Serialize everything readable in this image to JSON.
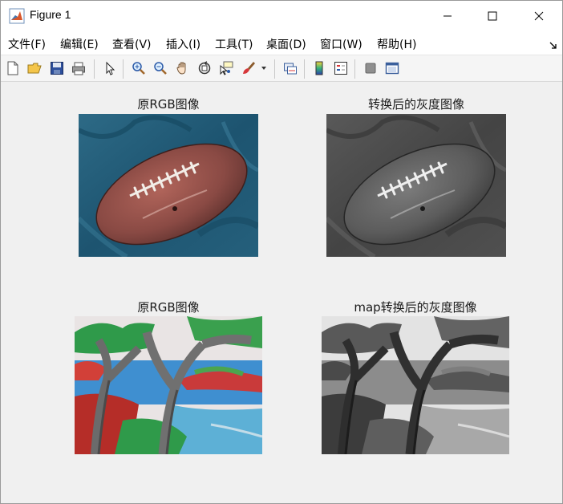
{
  "window": {
    "title": "Figure 1"
  },
  "menu": {
    "items": [
      {
        "label": "文件(F)"
      },
      {
        "label": "编辑(E)"
      },
      {
        "label": "查看(V)"
      },
      {
        "label": "插入(I)"
      },
      {
        "label": "工具(T)"
      },
      {
        "label": "桌面(D)"
      },
      {
        "label": "窗口(W)"
      },
      {
        "label": "帮助(H)"
      }
    ]
  },
  "toolbar": {
    "buttons": [
      "new-figure-icon",
      "open-icon",
      "save-icon",
      "print-icon",
      "edit-plot-icon",
      "zoom-in-icon",
      "zoom-out-icon",
      "pan-icon",
      "rotate-3d-icon",
      "data-cursor-icon",
      "brush-icon",
      "link-plot-icon",
      "colorbar-icon",
      "legend-icon",
      "hide-plot-tools-icon",
      "show-plot-tools-icon"
    ]
  },
  "figure": {
    "subplots": [
      {
        "title": "原RGB图像",
        "image": "color football on teal cloth"
      },
      {
        "title": "转换后的灰度图像",
        "image": "grayscale football on cloth"
      },
      {
        "title": "原RGB图像",
        "image": "colorful painted trees by a lake"
      },
      {
        "title": "map转换后的灰度图像",
        "image": "grayscale painted trees by a lake"
      }
    ]
  },
  "colors": {
    "figure_bg": "#f0f0f0",
    "titlebar_bg": "#ffffff",
    "toolbar_bg": "#f5f5f5"
  }
}
